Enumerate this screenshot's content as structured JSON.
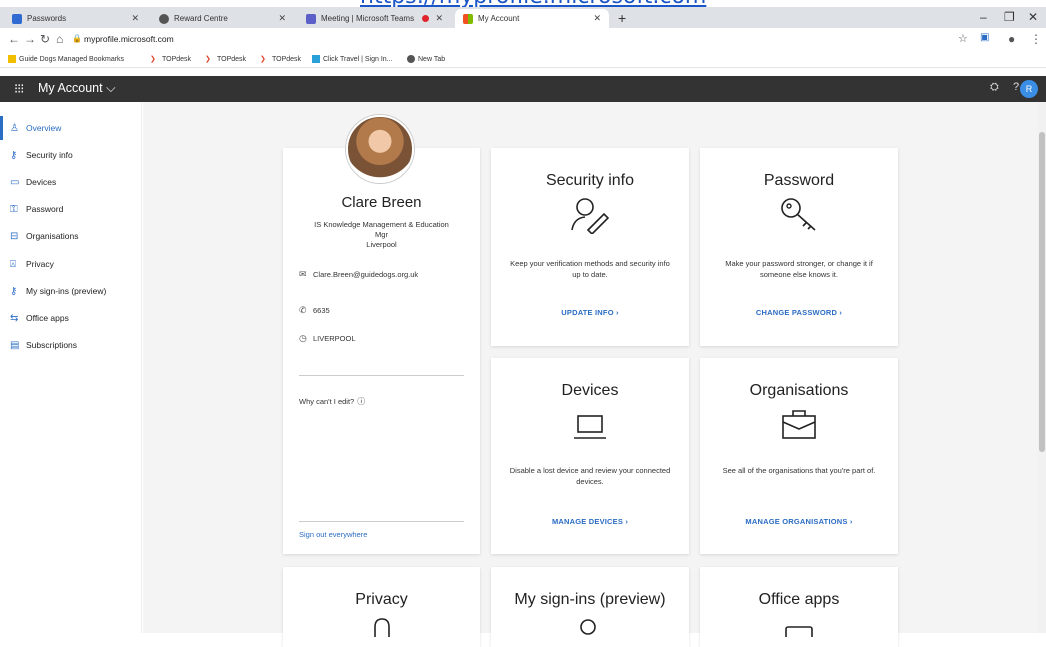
{
  "banner_url": "https://myprofile.microsoft.com",
  "tabs": [
    {
      "label": "Passwords",
      "fav_color": "#2f6bd1",
      "fav_text": "GD"
    },
    {
      "label": "Reward Centre",
      "fav_color": "#555555"
    },
    {
      "label": "Meeting | Microsoft Teams",
      "fav_color": "#5b5fc7"
    },
    {
      "label": "My Account",
      "fav_color": "#f25022"
    }
  ],
  "address": {
    "url": "myprofile.microsoft.com"
  },
  "bookmarks": [
    {
      "label": "Guide Dogs Managed Bookmarks",
      "color": "#f0c000"
    },
    {
      "label": "TOPdesk",
      "color": "#e0442b"
    },
    {
      "label": "TOPdesk",
      "color": "#e0442b"
    },
    {
      "label": "TOPdesk",
      "color": "#e0442b"
    },
    {
      "label": "Click Travel | Sign In...",
      "color": "#2aa0d8"
    },
    {
      "label": "New Tab",
      "color": "#555555"
    }
  ],
  "appbar": {
    "title": "My Account",
    "avatar_initial": "R"
  },
  "sidebar": {
    "items": [
      {
        "label": "Overview",
        "icon": "person-icon"
      },
      {
        "label": "Security info",
        "icon": "security-icon"
      },
      {
        "label": "Devices",
        "icon": "laptop-icon"
      },
      {
        "label": "Password",
        "icon": "key-icon"
      },
      {
        "label": "Organisations",
        "icon": "briefcase-icon"
      },
      {
        "label": "Privacy",
        "icon": "lock-icon"
      },
      {
        "label": "My sign-ins (preview)",
        "icon": "signin-icon"
      },
      {
        "label": "Office apps",
        "icon": "office-icon"
      },
      {
        "label": "Subscriptions",
        "icon": "card-icon"
      }
    ]
  },
  "profile": {
    "name": "Clare Breen",
    "role_line1": "IS Knowledge Management & Education",
    "role_line2": "Mgr",
    "role_line3": "Liverpool",
    "email": "Clare.Breen@guidedogs.org.uk",
    "phone": "6635",
    "location": "LIVERPOOL",
    "why_edit": "Why can't I edit?",
    "sign_out": "Sign out everywhere"
  },
  "cards": {
    "security": {
      "title": "Security info",
      "desc": "Keep your verification methods and security info up to date.",
      "link": "UPDATE INFO ›"
    },
    "password": {
      "title": "Password",
      "desc": "Make your password stronger, or change it if someone else knows it.",
      "link": "CHANGE PASSWORD ›"
    },
    "devices": {
      "title": "Devices",
      "desc": "Disable a lost device and review your connected devices.",
      "link": "MANAGE DEVICES ›"
    },
    "organisations": {
      "title": "Organisations",
      "desc": "See all of the organisations that you're part of.",
      "link": "MANAGE ORGANISATIONS ›"
    },
    "privacy": {
      "title": "Privacy"
    },
    "signins": {
      "title": "My sign-ins (preview)"
    },
    "officeapps": {
      "title": "Office apps"
    }
  }
}
